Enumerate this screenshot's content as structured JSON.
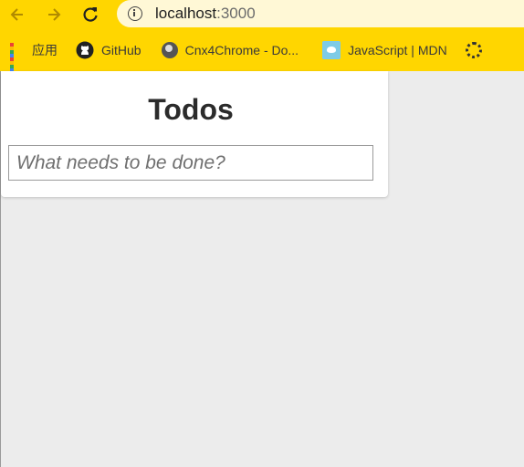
{
  "browser": {
    "url_host": "localhost",
    "url_port": ":3000"
  },
  "bookmarks": [
    {
      "label": "应用",
      "icon": "apps-grid-icon"
    },
    {
      "label": "GitHub",
      "icon": "github-icon"
    },
    {
      "label": "Cnx4Chrome - Do...",
      "icon": "cnx-globe-icon"
    },
    {
      "label": "JavaScript | MDN",
      "icon": "mdn-dino-icon"
    }
  ],
  "todo": {
    "title": "Todos",
    "placeholder": "What needs to be done?",
    "value": ""
  },
  "colors": {
    "chrome": "#ffd600",
    "page_bg": "#ececec"
  }
}
